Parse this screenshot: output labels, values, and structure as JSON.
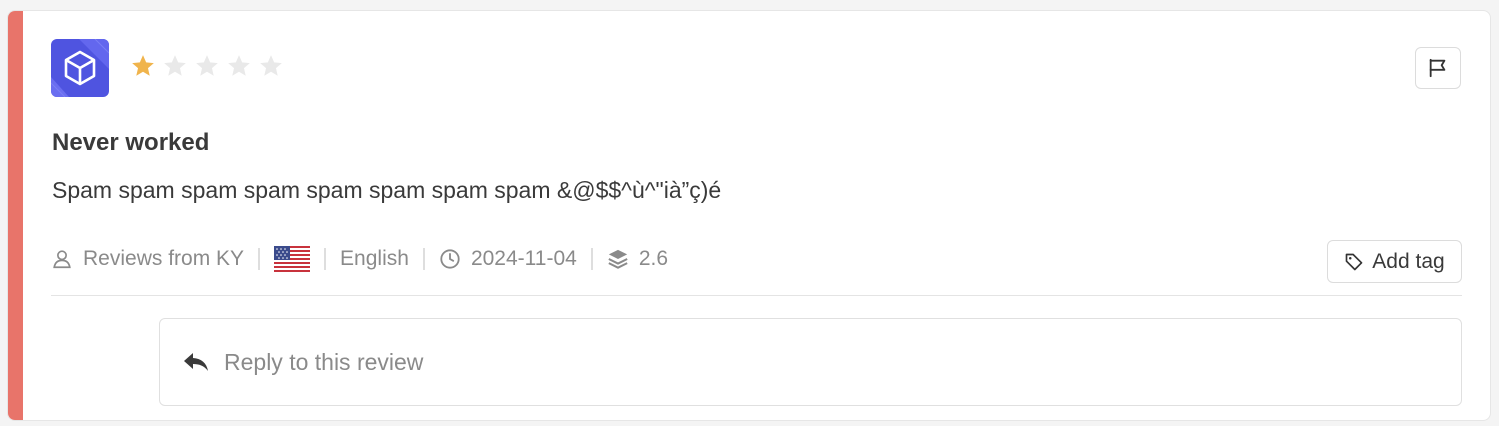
{
  "review": {
    "rating": 1,
    "max_rating": 5,
    "title": "Never worked",
    "body": "Spam spam spam spam spam spam spam spam &@$$^ù^\"ià”ç)é",
    "source": "Reviews from KY",
    "country_flag": "us-flag",
    "language": "English",
    "date": "2024-11-04",
    "version": "2.6"
  },
  "actions": {
    "add_tag_label": "Add tag",
    "reply_placeholder": "Reply to this review"
  },
  "icons": {
    "app": "cube-app-icon",
    "flag": "flag-icon",
    "user": "user-icon",
    "clock": "clock-icon",
    "layers": "layers-icon",
    "tag": "tag-icon",
    "reply": "reply-icon"
  },
  "colors": {
    "accent_bar": "#e8746a",
    "star_filled": "#f0b44c",
    "star_empty": "#e9e9e9",
    "app_icon": "#5b5fe8"
  }
}
